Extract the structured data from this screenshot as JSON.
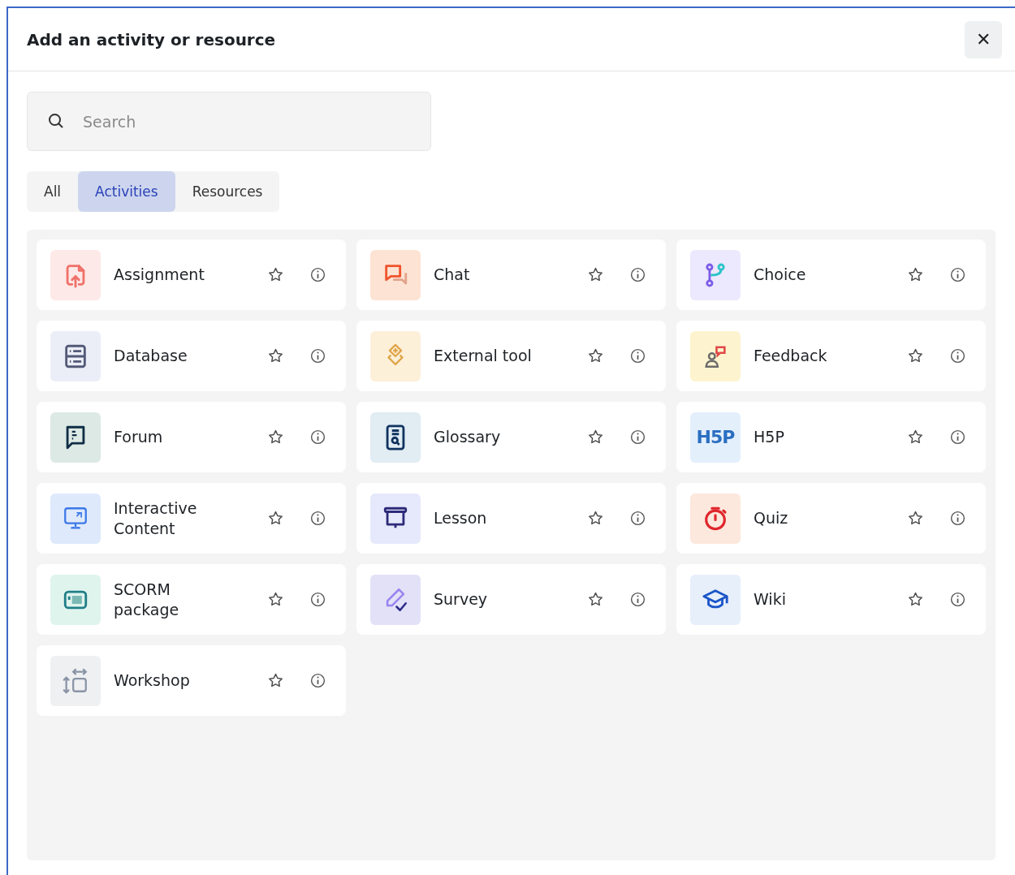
{
  "dialog": {
    "title": "Add an activity or resource",
    "close": "✕"
  },
  "search": {
    "placeholder": "Search"
  },
  "tabs": [
    {
      "label": "All",
      "selected": false
    },
    {
      "label": "Activities",
      "selected": true
    },
    {
      "label": "Resources",
      "selected": false
    }
  ],
  "items": [
    {
      "name": "Assignment",
      "kind": "assignment"
    },
    {
      "name": "Chat",
      "kind": "chat"
    },
    {
      "name": "Choice",
      "kind": "choice"
    },
    {
      "name": "Database",
      "kind": "database"
    },
    {
      "name": "External tool",
      "kind": "external"
    },
    {
      "name": "Feedback",
      "kind": "feedback"
    },
    {
      "name": "Forum",
      "kind": "forum"
    },
    {
      "name": "Glossary",
      "kind": "glossary"
    },
    {
      "name": "H5P",
      "kind": "h5p",
      "icon_text": "H5P"
    },
    {
      "name": "Interactive Content",
      "kind": "interactive"
    },
    {
      "name": "Lesson",
      "kind": "lesson"
    },
    {
      "name": "Quiz",
      "kind": "quiz"
    },
    {
      "name": "SCORM package",
      "kind": "scorm"
    },
    {
      "name": "Survey",
      "kind": "survey"
    },
    {
      "name": "Wiki",
      "kind": "wiki"
    },
    {
      "name": "Workshop",
      "kind": "workshop"
    }
  ]
}
